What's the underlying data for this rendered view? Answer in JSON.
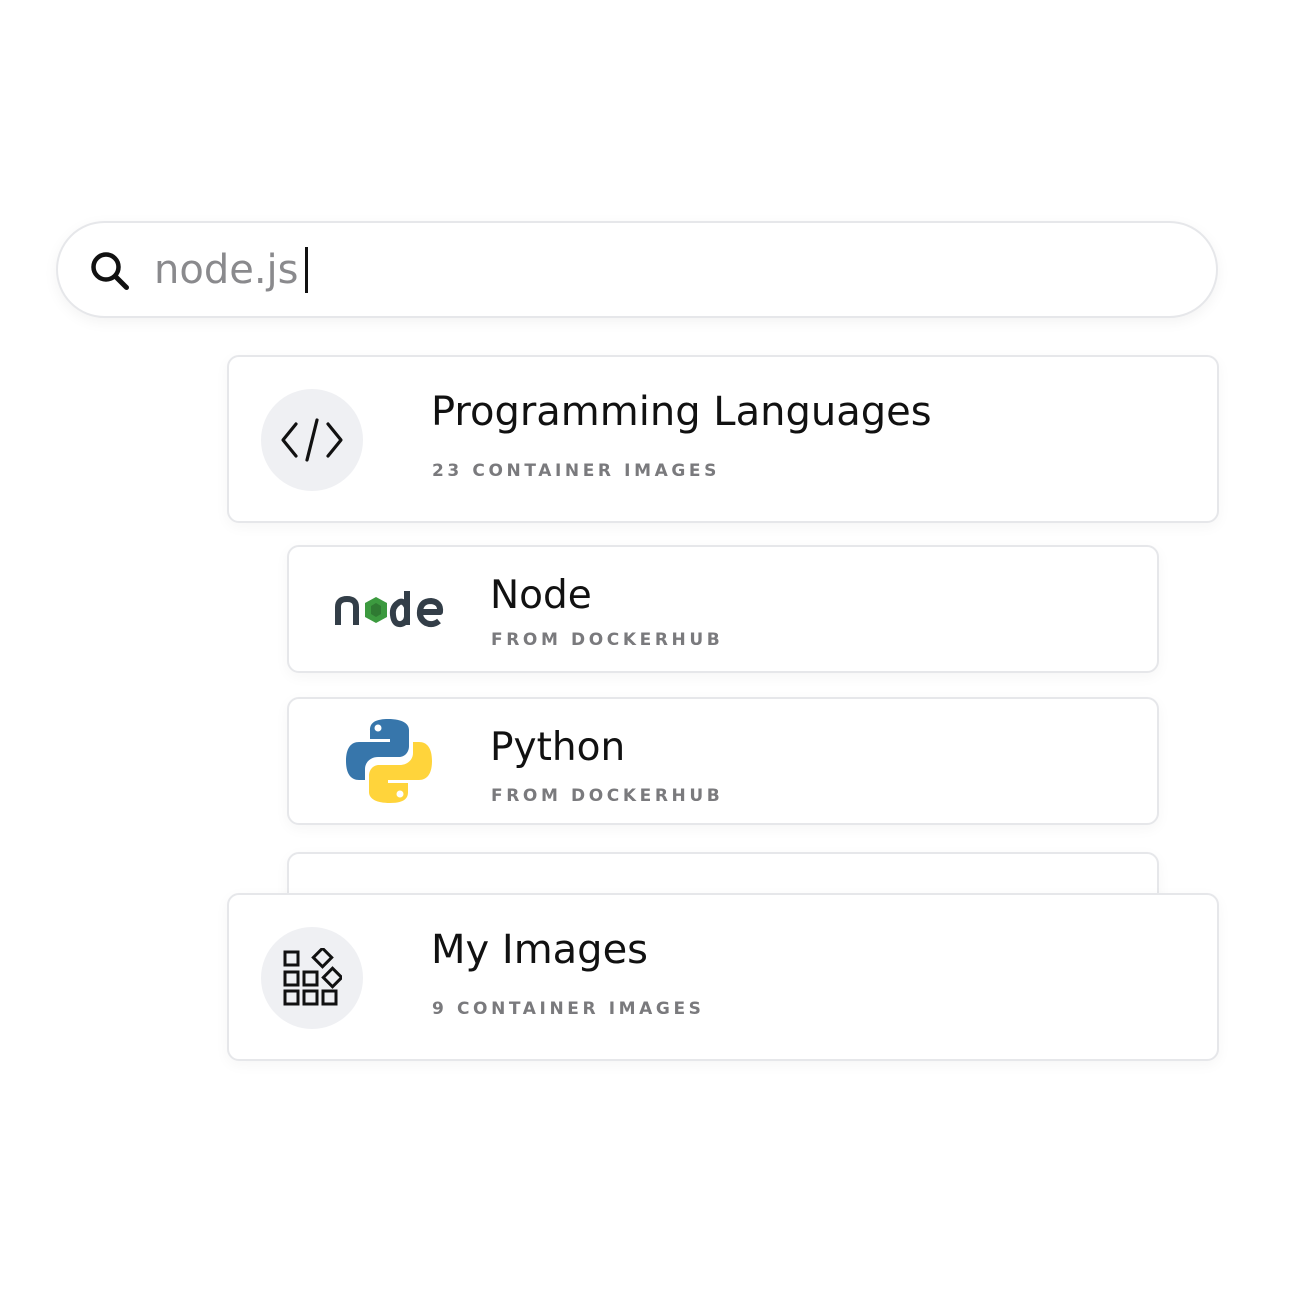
{
  "search": {
    "value": "node.js",
    "icon": "search-icon"
  },
  "categories": {
    "programming": {
      "title": "Programming Languages",
      "subtitle": "23 CONTAINER IMAGES",
      "icon": "code-icon"
    },
    "my_images": {
      "title": "My Images",
      "subtitle": "9 CONTAINER IMAGES",
      "icon": "apps-icon"
    }
  },
  "items": [
    {
      "title": "Node",
      "subtitle": "FROM DOCKERHUB",
      "icon": "nodejs-logo"
    },
    {
      "title": "Python",
      "subtitle": "FROM DOCKERHUB",
      "icon": "python-logo"
    }
  ],
  "colors": {
    "card_border": "#e6e7ea",
    "icon_circle_bg": "#eff0f3",
    "title_text": "#111111",
    "subtitle_text": "#7a7a7d",
    "node_dark": "#333e48",
    "node_green": "#3c9a3f",
    "python_blue": "#3776ab",
    "python_yellow": "#ffd43b"
  }
}
